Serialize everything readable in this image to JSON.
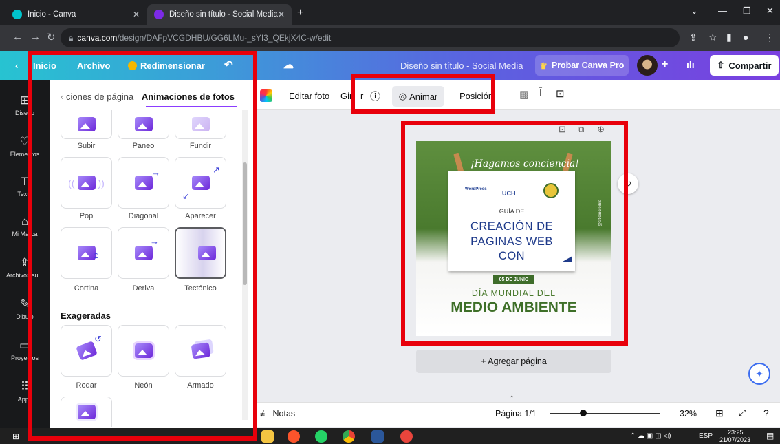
{
  "browser": {
    "tabs": [
      {
        "title": "Inicio - Canva"
      },
      {
        "title": "Diseño sin título - Social Media"
      }
    ],
    "url_host": "canva.com",
    "url_path": "/design/DAFpVCGDHBU/GG6LMu-_sYI3_QEkjX4C-w/edit"
  },
  "header": {
    "home": "Inicio",
    "file": "Archivo",
    "resize": "Redimensionar",
    "doc_title": "Diseño sin título - Social Media",
    "try_pro": "Probar Canva Pro",
    "share": "Compartir"
  },
  "rail": {
    "items": [
      "Diseño",
      "Elementos",
      "Texto",
      "Mi Marca",
      "Archivos su...",
      "Dibujo",
      "Proyectos",
      "Apps"
    ]
  },
  "panel": {
    "tab_prev": "ciones de página",
    "tab_active": "Animaciones de fotos",
    "row0": [
      "Subir",
      "Paneo",
      "Fundir"
    ],
    "row1": [
      "Pop",
      "Diagonal",
      "Aparecer"
    ],
    "row2": [
      "Cortina",
      "Deriva",
      "Tectónico"
    ],
    "section": "Exageradas",
    "row3": [
      "Rodar",
      "Neón",
      "Armado"
    ]
  },
  "toolbar": {
    "edit_photo": "Editar foto",
    "rotate": "Gir",
    "rotate_tail": "r",
    "animate": "Animar",
    "position": "Posición"
  },
  "design": {
    "tagline": "¡Hagamos conciencia!",
    "logo1": "WordPress",
    "logo2": "UCH",
    "guide": "GUÍA DE",
    "line1": "CREACIÓN DE",
    "line2": "PAGINAS WEB",
    "line3": "CON",
    "date": "05 DE JUNIO",
    "day": "DÍA MUNDIAL DEL",
    "title": "MEDIO AMBIENTE",
    "handle": "@sitioincreible"
  },
  "canvas": {
    "add_page": "+ Agregar página"
  },
  "footer": {
    "notes": "Notas",
    "page": "Página 1/1",
    "zoom": "32%",
    "zoom_fraction": 0.32
  },
  "taskbar": {
    "lang": "ESP",
    "time": "23:25",
    "date": "21/07/2023"
  },
  "colors": {
    "accent": "#8b3dff",
    "highlight": "#e8000b"
  }
}
